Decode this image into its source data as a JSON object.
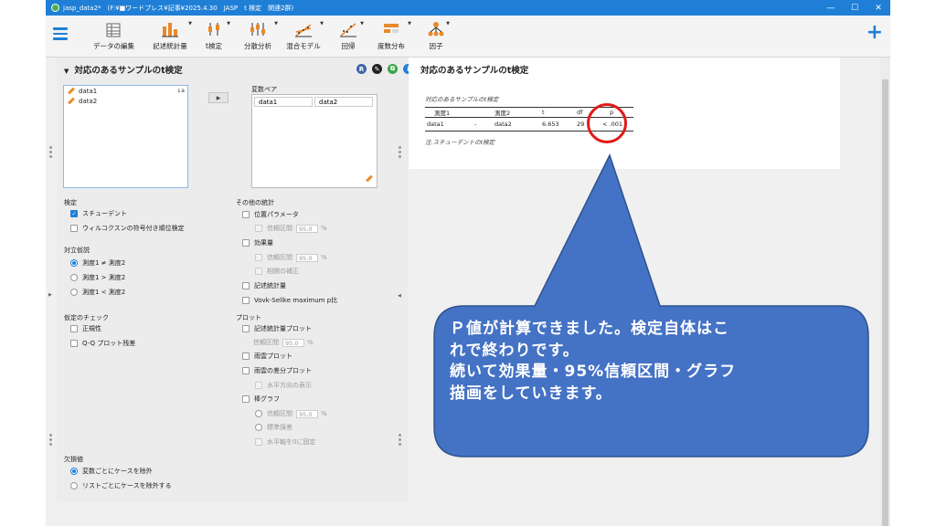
{
  "window": {
    "title": "jasp_data2*　(F:¥■ワードプレス¥記事¥2025.4.30　JASP　t 検定　関連2群)",
    "minimize": "—",
    "maximize": "☐",
    "close": "✕"
  },
  "toolbar": {
    "items": [
      {
        "label": "データの編集",
        "icon": "spreadsheet-icon"
      },
      {
        "label": "記述統計量",
        "icon": "bar-chart-icon"
      },
      {
        "label": "t検定",
        "icon": "t-test-icon"
      },
      {
        "label": "分散分析",
        "icon": "anova-icon"
      },
      {
        "label": "混合モデル",
        "icon": "mixed-model-icon"
      },
      {
        "label": "回帰",
        "icon": "regression-icon"
      },
      {
        "label": "度数分布",
        "icon": "frequencies-icon"
      },
      {
        "label": "因子",
        "icon": "factor-icon"
      }
    ],
    "plus": "+"
  },
  "analysis": {
    "title": "対応のあるサンプルのt検定",
    "icons": {
      "r": "R",
      "info": "i",
      "close": "×"
    },
    "variables": [
      "data1",
      "data2"
    ],
    "sort_icon": "↓a",
    "arrow": "▶",
    "pair_label": "変数ペア",
    "pair": [
      "data1",
      "data2"
    ],
    "test": {
      "header": "検定",
      "student": "スチューデント",
      "wilcoxon": "ウィルコクスンの符号付き順位検定"
    },
    "alt": {
      "header": "対立仮説",
      "neq": "測度1 ≠ 測度2",
      "gt": "測度1 > 測度2",
      "lt": "測度1 < 測度2"
    },
    "assump": {
      "header": "仮定のチェック",
      "normality": "正規性",
      "qq": "Q-Q プロット残差"
    },
    "other": {
      "header": "その他の統計",
      "location": "位置パラメータ",
      "ci": "信頼区間",
      "ci_val": "95.0",
      "pct": "%",
      "effect": "効果量",
      "corr": "相関の補正",
      "desc": "記述統計量",
      "vs": "Vovk-Sellke maximum p比"
    },
    "plots": {
      "header": "プロット",
      "desc_plot": "記述統計量プロット",
      "ci": "信頼区間",
      "ci_val": "95.0",
      "pct": "%",
      "raincloud": "雨雲プロット",
      "raincloud_diff": "雨雲の差分プロット",
      "horizontal": "水平方向の表示",
      "bar": "棒グラフ",
      "bar_ci": "信頼区間",
      "bar_ci_val": "95.0",
      "bar_pct": "%",
      "se": "標準誤差",
      "fix_zero": "水平軸を0に固定"
    },
    "missing": {
      "header": "欠損値",
      "by_var": "変数ごとにケースを除外",
      "listwise": "リストごとにケースを除外する"
    }
  },
  "results": {
    "title": "対応のあるサンプルのt検定",
    "caption": "対応のあるサンプルのt検定",
    "columns": [
      "測度1",
      "",
      "測度2",
      "t",
      "df",
      "p"
    ],
    "row": [
      "data1",
      "-",
      "data2",
      "6.653",
      "29",
      "< .001"
    ],
    "note": "注.スチューデントのt検定"
  },
  "callout": {
    "lines": [
      "Ｐ値が計算できました。検定自体はこ",
      "れで終わりです。",
      "続いて効果量・95%信頼区間・グラフ",
      "描画をしていきます。"
    ],
    "color": "#4472c4"
  }
}
